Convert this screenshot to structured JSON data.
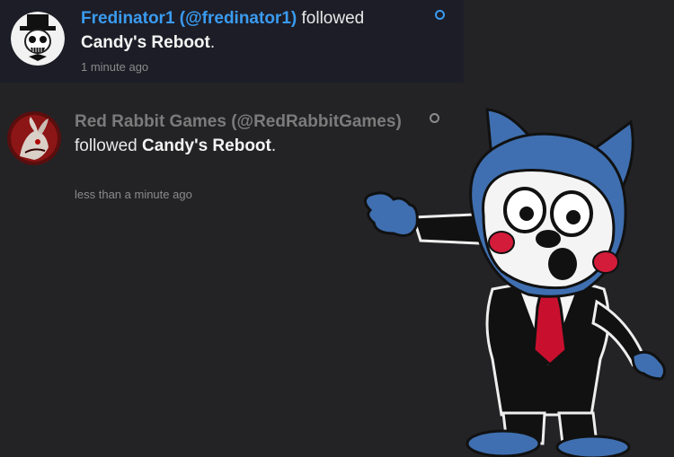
{
  "notifications": [
    {
      "actor": "Fredinator1 (@fredinator1)",
      "verb": "followed",
      "target": "Candy's Reboot",
      "period": ".",
      "time": "1 minute ago",
      "unread": true,
      "accent": "#3a9bf0",
      "avatar_icon": "skull-tophat-avatar"
    },
    {
      "actor": "Red Rabbit Games (@RedRabbitGames)",
      "verb": "followed",
      "target": "Candy's Reboot",
      "period": ".",
      "time": "less than a minute ago",
      "unread": false,
      "accent": "#8b8b8b",
      "avatar_icon": "red-rabbit-avatar"
    }
  ],
  "colors": {
    "background": "#232325",
    "unread_background": "#1d1d27",
    "link_blue": "#3a9bf0"
  }
}
